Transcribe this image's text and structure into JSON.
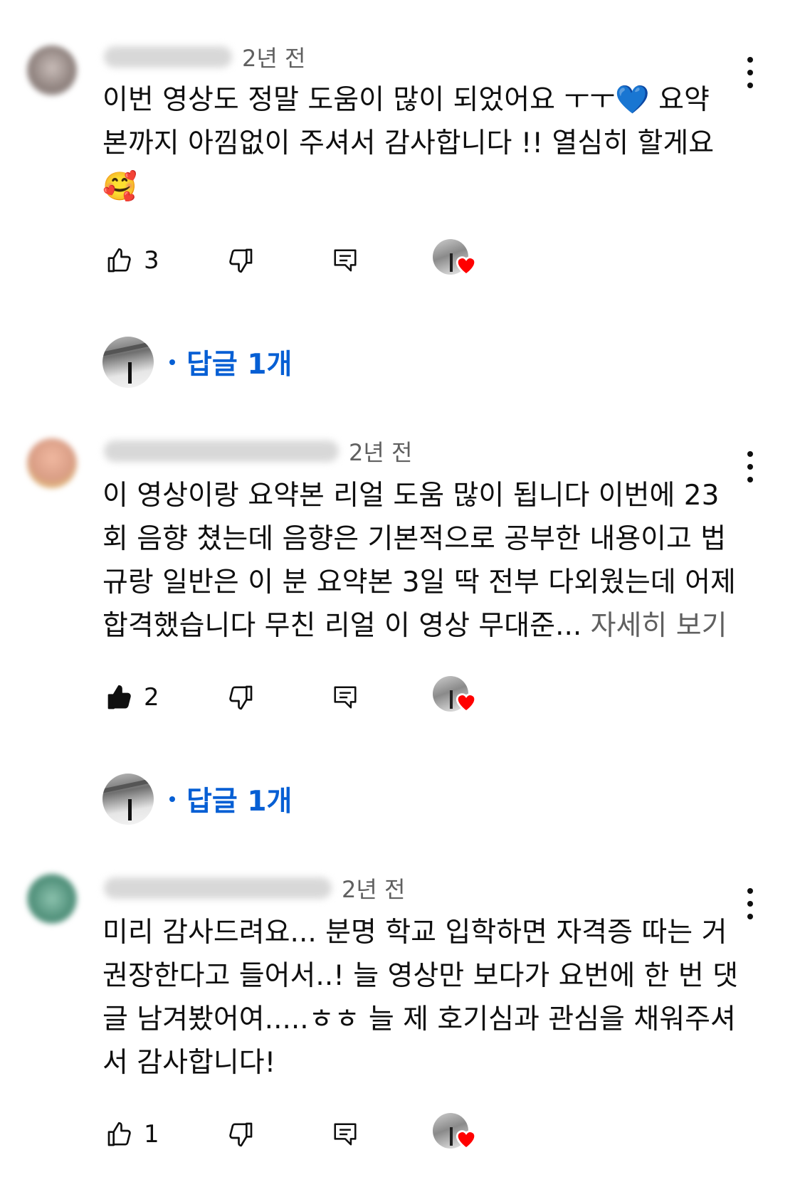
{
  "comments": [
    {
      "time": "2년 전",
      "text_lines": [
        "이번 영상도 정말 도움이 많이 되었어요 ㅜㅜ💙 요약",
        "본까지 아낌없이 주셔서 감사합니다 !! 열심히 할게요",
        "🥰"
      ],
      "likes": "3",
      "liked": false,
      "replies_label": "답글 1개",
      "avatar_color": "#b8a9a6"
    },
    {
      "time": "2년 전",
      "text_lines": [
        "이 영상이랑 요약본 리얼 도움 많이 됩니다 이번에 23",
        "회 음향 쳤는데 음향은 기본적으로 공부한 내용이고 법",
        "규랑 일반은 이 분 요약본 3일 딱 전부 다외웠는데 어제",
        "합격했습니다 무친 리얼 이 영상 무대준..."
      ],
      "more_label": " 자세히 보기",
      "likes": "2",
      "liked": true,
      "replies_label": "답글 1개",
      "avatar_color": "#e6a992"
    },
    {
      "time": "2년 전",
      "text_lines": [
        "미리 감사드려요... 분명 학교 입학하면 자격증 따는 거",
        "권장한다고 들어서..! 늘 영상만 보다가 요번에 한 번 댓",
        "글 남겨봤어여.....ㅎㅎ 늘 제 호기심과 관심을 채워주셔",
        "서 감사합니다!"
      ],
      "likes": "1",
      "liked": false,
      "avatar_color": "#5f9c86"
    }
  ],
  "colors": {
    "link": "#065fd4",
    "text": "#0f0f0f",
    "muted": "#606060",
    "heart": "#ff0000"
  },
  "icons": [
    "thumb-up-icon",
    "thumb-down-icon",
    "reply-icon",
    "creator-heart-icon",
    "more-vert-icon"
  ]
}
